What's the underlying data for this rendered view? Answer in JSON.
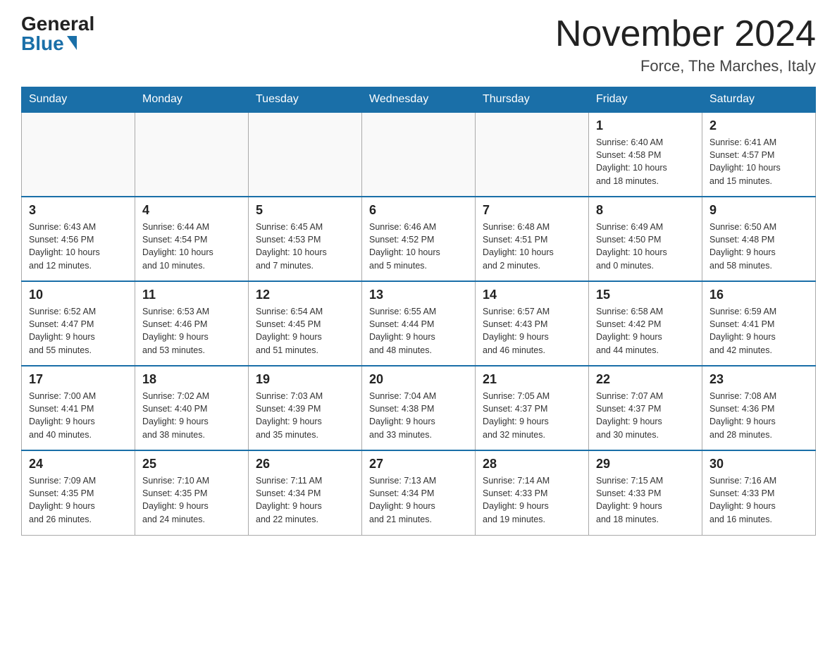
{
  "header": {
    "logo_general": "General",
    "logo_blue": "Blue",
    "month_title": "November 2024",
    "location": "Force, The Marches, Italy"
  },
  "weekdays": [
    "Sunday",
    "Monday",
    "Tuesday",
    "Wednesday",
    "Thursday",
    "Friday",
    "Saturday"
  ],
  "weeks": [
    [
      {
        "day": "",
        "info": ""
      },
      {
        "day": "",
        "info": ""
      },
      {
        "day": "",
        "info": ""
      },
      {
        "day": "",
        "info": ""
      },
      {
        "day": "",
        "info": ""
      },
      {
        "day": "1",
        "info": "Sunrise: 6:40 AM\nSunset: 4:58 PM\nDaylight: 10 hours\nand 18 minutes."
      },
      {
        "day": "2",
        "info": "Sunrise: 6:41 AM\nSunset: 4:57 PM\nDaylight: 10 hours\nand 15 minutes."
      }
    ],
    [
      {
        "day": "3",
        "info": "Sunrise: 6:43 AM\nSunset: 4:56 PM\nDaylight: 10 hours\nand 12 minutes."
      },
      {
        "day": "4",
        "info": "Sunrise: 6:44 AM\nSunset: 4:54 PM\nDaylight: 10 hours\nand 10 minutes."
      },
      {
        "day": "5",
        "info": "Sunrise: 6:45 AM\nSunset: 4:53 PM\nDaylight: 10 hours\nand 7 minutes."
      },
      {
        "day": "6",
        "info": "Sunrise: 6:46 AM\nSunset: 4:52 PM\nDaylight: 10 hours\nand 5 minutes."
      },
      {
        "day": "7",
        "info": "Sunrise: 6:48 AM\nSunset: 4:51 PM\nDaylight: 10 hours\nand 2 minutes."
      },
      {
        "day": "8",
        "info": "Sunrise: 6:49 AM\nSunset: 4:50 PM\nDaylight: 10 hours\nand 0 minutes."
      },
      {
        "day": "9",
        "info": "Sunrise: 6:50 AM\nSunset: 4:48 PM\nDaylight: 9 hours\nand 58 minutes."
      }
    ],
    [
      {
        "day": "10",
        "info": "Sunrise: 6:52 AM\nSunset: 4:47 PM\nDaylight: 9 hours\nand 55 minutes."
      },
      {
        "day": "11",
        "info": "Sunrise: 6:53 AM\nSunset: 4:46 PM\nDaylight: 9 hours\nand 53 minutes."
      },
      {
        "day": "12",
        "info": "Sunrise: 6:54 AM\nSunset: 4:45 PM\nDaylight: 9 hours\nand 51 minutes."
      },
      {
        "day": "13",
        "info": "Sunrise: 6:55 AM\nSunset: 4:44 PM\nDaylight: 9 hours\nand 48 minutes."
      },
      {
        "day": "14",
        "info": "Sunrise: 6:57 AM\nSunset: 4:43 PM\nDaylight: 9 hours\nand 46 minutes."
      },
      {
        "day": "15",
        "info": "Sunrise: 6:58 AM\nSunset: 4:42 PM\nDaylight: 9 hours\nand 44 minutes."
      },
      {
        "day": "16",
        "info": "Sunrise: 6:59 AM\nSunset: 4:41 PM\nDaylight: 9 hours\nand 42 minutes."
      }
    ],
    [
      {
        "day": "17",
        "info": "Sunrise: 7:00 AM\nSunset: 4:41 PM\nDaylight: 9 hours\nand 40 minutes."
      },
      {
        "day": "18",
        "info": "Sunrise: 7:02 AM\nSunset: 4:40 PM\nDaylight: 9 hours\nand 38 minutes."
      },
      {
        "day": "19",
        "info": "Sunrise: 7:03 AM\nSunset: 4:39 PM\nDaylight: 9 hours\nand 35 minutes."
      },
      {
        "day": "20",
        "info": "Sunrise: 7:04 AM\nSunset: 4:38 PM\nDaylight: 9 hours\nand 33 minutes."
      },
      {
        "day": "21",
        "info": "Sunrise: 7:05 AM\nSunset: 4:37 PM\nDaylight: 9 hours\nand 32 minutes."
      },
      {
        "day": "22",
        "info": "Sunrise: 7:07 AM\nSunset: 4:37 PM\nDaylight: 9 hours\nand 30 minutes."
      },
      {
        "day": "23",
        "info": "Sunrise: 7:08 AM\nSunset: 4:36 PM\nDaylight: 9 hours\nand 28 minutes."
      }
    ],
    [
      {
        "day": "24",
        "info": "Sunrise: 7:09 AM\nSunset: 4:35 PM\nDaylight: 9 hours\nand 26 minutes."
      },
      {
        "day": "25",
        "info": "Sunrise: 7:10 AM\nSunset: 4:35 PM\nDaylight: 9 hours\nand 24 minutes."
      },
      {
        "day": "26",
        "info": "Sunrise: 7:11 AM\nSunset: 4:34 PM\nDaylight: 9 hours\nand 22 minutes."
      },
      {
        "day": "27",
        "info": "Sunrise: 7:13 AM\nSunset: 4:34 PM\nDaylight: 9 hours\nand 21 minutes."
      },
      {
        "day": "28",
        "info": "Sunrise: 7:14 AM\nSunset: 4:33 PM\nDaylight: 9 hours\nand 19 minutes."
      },
      {
        "day": "29",
        "info": "Sunrise: 7:15 AM\nSunset: 4:33 PM\nDaylight: 9 hours\nand 18 minutes."
      },
      {
        "day": "30",
        "info": "Sunrise: 7:16 AM\nSunset: 4:33 PM\nDaylight: 9 hours\nand 16 minutes."
      }
    ]
  ]
}
